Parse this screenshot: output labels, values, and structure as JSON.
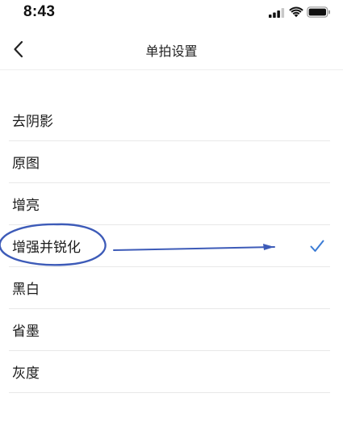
{
  "status_bar": {
    "time": "8:43",
    "icons": [
      "signal-icon",
      "wifi-icon",
      "battery-icon"
    ]
  },
  "nav": {
    "back_icon": "chevron-left-icon",
    "title": "单拍设置"
  },
  "options": [
    {
      "label": "去阴影",
      "selected": false
    },
    {
      "label": "原图",
      "selected": false
    },
    {
      "label": "增亮",
      "selected": false
    },
    {
      "label": "增强并锐化",
      "selected": true
    },
    {
      "label": "黑白",
      "selected": false
    },
    {
      "label": "省墨",
      "selected": false
    },
    {
      "label": "灰度",
      "selected": false
    }
  ],
  "colors": {
    "accent": "#3a7bd5",
    "annotation": "#3d5bb8",
    "divider": "#e8e8e8"
  },
  "annotation": {
    "shapes": [
      "circle-mark",
      "arrow-mark"
    ]
  }
}
